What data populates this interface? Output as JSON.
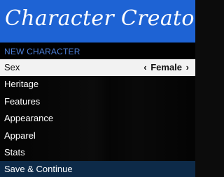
{
  "title": "Character Creator",
  "subtitle": "NEW CHARACTER",
  "menu": {
    "sex": {
      "label": "Sex",
      "value": "Female",
      "arrow_left": "‹",
      "arrow_right": "›"
    },
    "heritage": "Heritage",
    "features": "Features",
    "appearance": "Appearance",
    "apparel": "Apparel",
    "stats": "Stats",
    "save": "Save & Continue"
  },
  "colors": {
    "header": "#1e63d4",
    "subtitle_text": "#4c7fd8",
    "selected_row": "#f2f2f2",
    "save_row": "#0d2a48"
  }
}
